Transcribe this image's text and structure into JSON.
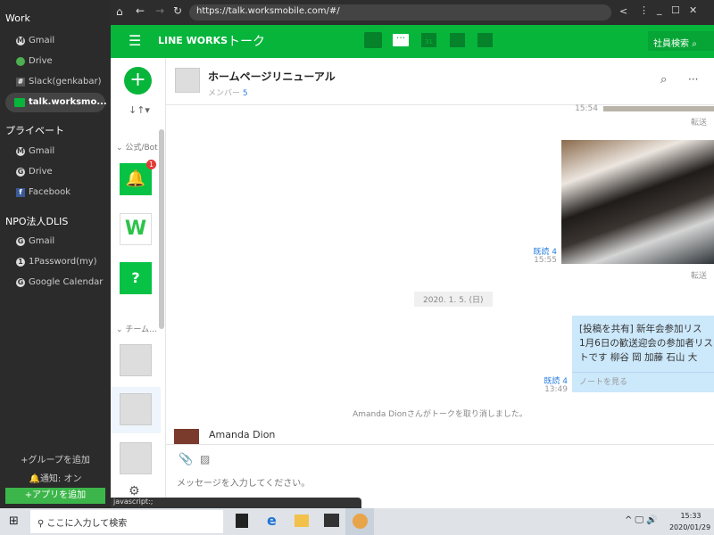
{
  "sidebar": {
    "sections": [
      {
        "title": "Work",
        "items": [
          "Gmail",
          "Drive",
          "Slack(genkabar)",
          "talk.worksmo..."
        ]
      },
      {
        "title": "プライベート",
        "items": [
          "Gmail",
          "Drive",
          "Facebook"
        ]
      },
      {
        "title": "NPO法人DLIS",
        "items": [
          "Gmail",
          "1Password(my)",
          "Google Calendar"
        ]
      }
    ],
    "add_group": "+グループを追加",
    "notify": "通知: オン",
    "add_app": "+アプリを追加"
  },
  "browser": {
    "url": "https://talk.worksmobile.com/#/",
    "status": "javascript:;"
  },
  "app": {
    "brand": "LINE WORKS",
    "title": "トーク",
    "search_label": "社員検索"
  },
  "column": {
    "section_bot": "公式/Bot",
    "section_team": "チーム…",
    "badge": "1"
  },
  "chat": {
    "title": "ホームページリニューアル",
    "members_label": "メンバー",
    "members_count": "5",
    "msgs": [
      {
        "time": "15:54",
        "forward": "転送"
      },
      {
        "read": "既読 4",
        "time": "15:55",
        "forward": "転送"
      }
    ],
    "date": "2020. 1. 5. (日)",
    "note": {
      "lines": [
        "[投稿を共有] 新年会参加リス",
        "1月6日の歓送迎会の参加者リス",
        "トです  柳谷 岡 加藤 石山 大"
      ],
      "link": "ノートを見る",
      "read": "既読 4",
      "time": "13:49"
    },
    "system": "Amanda Dionさんがトークを取り消しました。",
    "sender": "Amanda Dion",
    "placeholder": "メッセージを入力してください。"
  },
  "taskbar": {
    "search": "ここに入力して検索",
    "time": "15:33",
    "date": "2020/01/29"
  },
  "colors": {
    "green": "#07b53b",
    "bubble": "#cce8fb"
  }
}
